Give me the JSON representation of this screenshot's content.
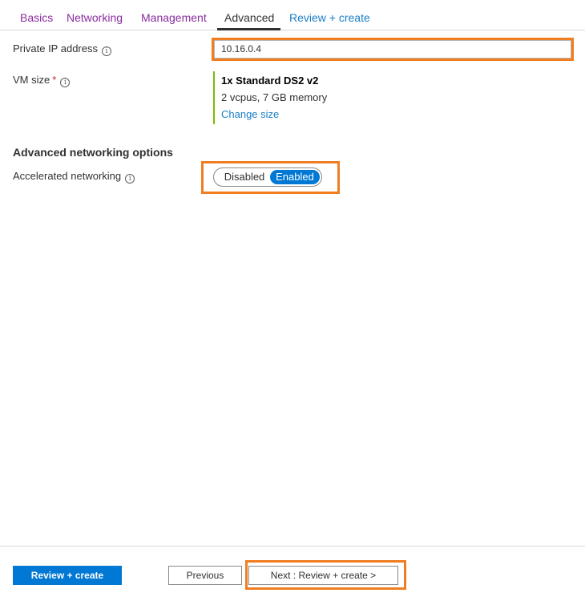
{
  "tabs": [
    {
      "label": "Basics",
      "state": "visited"
    },
    {
      "label": "Networking",
      "state": "visited"
    },
    {
      "label": "Management",
      "state": "visited"
    },
    {
      "label": "Advanced",
      "state": "active"
    },
    {
      "label": "Review + create",
      "state": "link"
    }
  ],
  "form": {
    "private_ip": {
      "label": "Private IP address",
      "value": "10.16.0.4"
    },
    "vm_size": {
      "label": "VM size",
      "required_marker": "*",
      "name": "1x Standard DS2 v2",
      "spec": "2 vcpus, 7 GB memory",
      "change_link": "Change size"
    },
    "advanced_networking": {
      "heading": "Advanced networking options",
      "accelerated": {
        "label": "Accelerated networking",
        "off_label": "Disabled",
        "on_label": "Enabled",
        "selected": "Enabled"
      }
    },
    "info_icon_glyph": "i"
  },
  "footer": {
    "review_create": "Review + create",
    "previous": "Previous",
    "next": "Next : Review + create >"
  },
  "colors": {
    "accent": "#0078d4",
    "highlight": "#f07e20",
    "visited_tab": "#8a2ca0",
    "link": "#1a7fc6",
    "vm_bar": "#7fba00"
  }
}
